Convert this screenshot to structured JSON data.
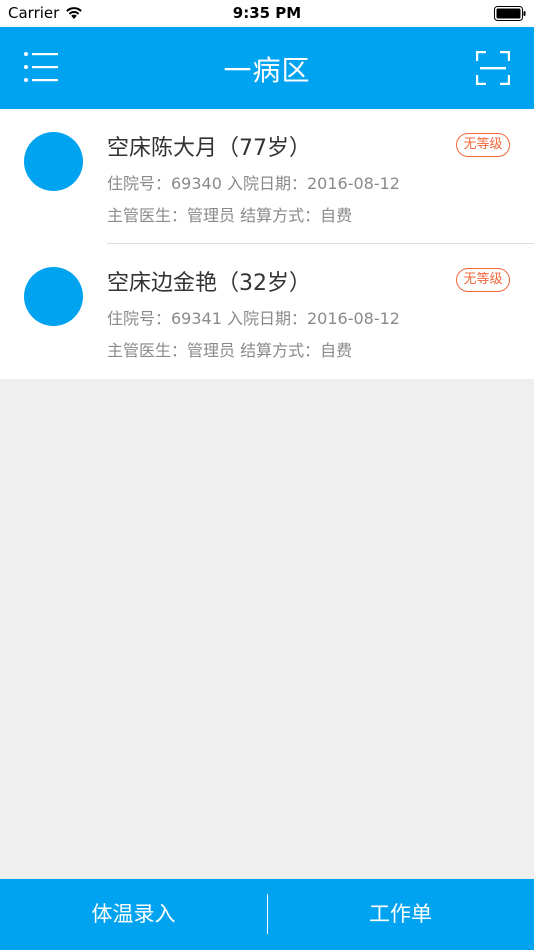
{
  "status_bar": {
    "carrier": "Carrier",
    "time": "9:35 PM"
  },
  "nav": {
    "title": "一病区",
    "menu_icon": "menu-icon",
    "scan_icon": "scan-icon"
  },
  "patients": [
    {
      "name": "空床陈大月（77岁）",
      "info_line1": "住院号：69340 入院日期：2016-08-12",
      "info_line2": "主管医生：管理员 结算方式：自费",
      "badge": "无等级"
    },
    {
      "name": "空床边金艳（32岁）",
      "info_line1": "住院号：69341 入院日期：2016-08-12",
      "info_line2": "主管医生：管理员 结算方式：自费",
      "badge": "无等级"
    }
  ],
  "tabs": [
    {
      "label": "体温录入"
    },
    {
      "label": "工作单"
    }
  ],
  "colors": {
    "accent": "#00a3ef",
    "badge": "#f0683c",
    "background": "#efefef"
  }
}
